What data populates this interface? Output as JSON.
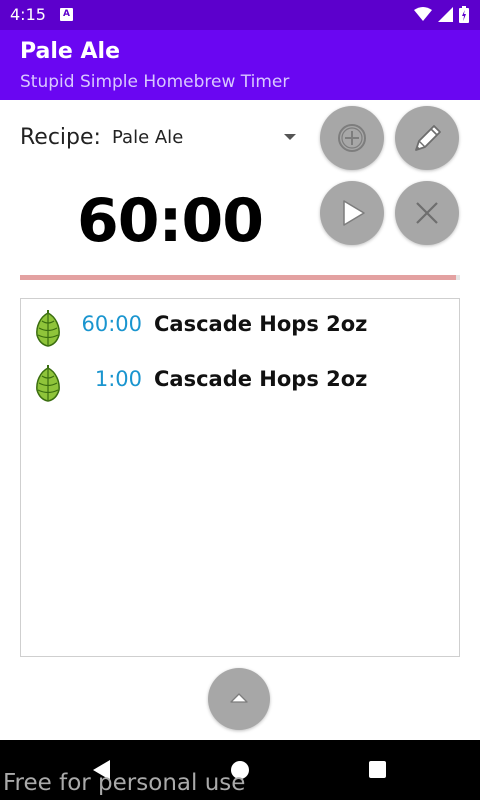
{
  "status_bar": {
    "time": "4:15",
    "notification_badge": "A"
  },
  "app_bar": {
    "title": "Pale Ale",
    "subtitle": "Stupid Simple Homebrew Timer"
  },
  "recipe": {
    "label": "Recipe:",
    "selected": "Pale Ale"
  },
  "timer": {
    "display": "60:00",
    "progress_fraction": 0.99
  },
  "schedule": {
    "items": [
      {
        "time": "60:00",
        "name": "Cascade Hops 2oz",
        "icon": "hop-icon"
      },
      {
        "time": "1:00",
        "name": "Cascade Hops 2oz",
        "icon": "hop-icon"
      }
    ]
  },
  "buttons": [
    "add-icon",
    "edit-icon",
    "play-icon",
    "close-icon",
    "expand-up-icon"
  ],
  "nav": [
    "back-icon",
    "home-icon",
    "recents-icon"
  ],
  "watermark": "Free for personal use",
  "colors": {
    "status_bar": "#5c00cc",
    "app_bar": "#6a06f2",
    "accent_time": "#1a95cf",
    "progress": "#e3a1a1",
    "round_button": "#a7a7a7"
  }
}
